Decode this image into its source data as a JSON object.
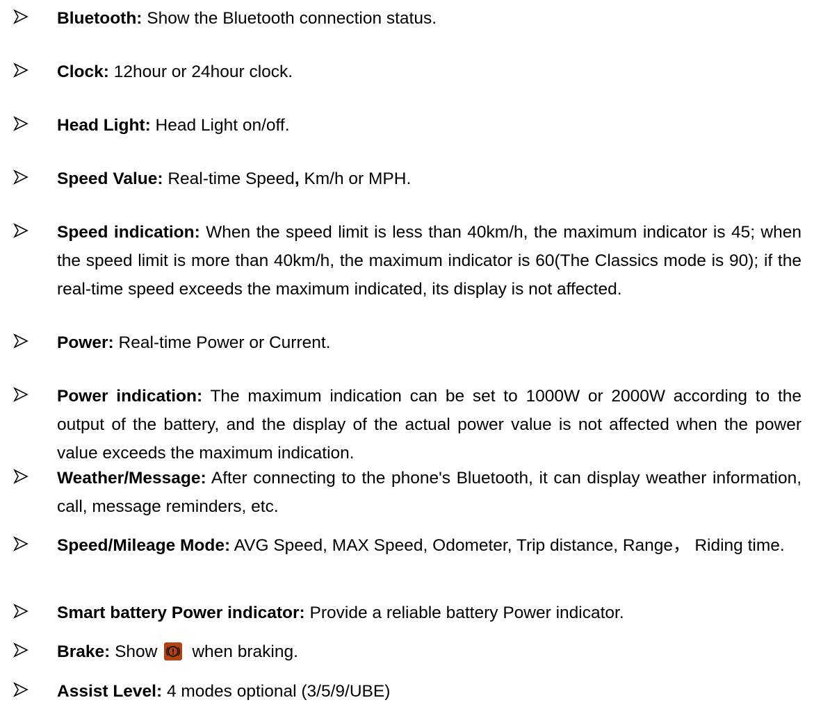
{
  "items": [
    {
      "term": "Bluetooth:",
      "desc": " Show the Bluetooth connection status."
    },
    {
      "term": "Clock:",
      "desc": " 12hour or 24hour clock."
    },
    {
      "term": "Head Light:",
      "desc": " Head Light on/off."
    },
    {
      "term": "Speed Value:",
      "desc": " Real-time Speed",
      "desc_bold": ",",
      "desc_after": " Km/h or MPH."
    },
    {
      "term": "Speed indication:",
      "desc": " When the speed limit is less than 40km/h, the maximum indicator is 45; when the speed limit is more than 40km/h, the maximum indicator is 60(The Classics mode is 90); if the real-time speed exceeds the maximum indicated, its display is not affected."
    },
    {
      "term": "Power:",
      "desc": " Real-time Power or Current."
    },
    {
      "term": "Power indication:",
      "desc": " The maximum indication can be set to 1000W or 2000W according to the output of the battery, and the display of the actual power value is not affected when the power value exceeds the maximum indication."
    },
    {
      "term": "Weather/Message:",
      "desc": " After connecting to the phone's Bluetooth, it can display weather information, call, message reminders, etc."
    },
    {
      "term": "Speed/Mileage Mode:",
      "desc": " AVG Speed, MAX Speed, Odometer, Trip distance, Range， Riding time."
    },
    {
      "term": "Smart battery Power indicator:",
      "desc": " Provide a reliable battery Power indicator."
    },
    {
      "term": "Brake:",
      "desc_before_icon": " Show",
      "icon": "brake-warning-icon",
      "desc_after_icon": "when braking."
    },
    {
      "term": "Assist Level:",
      "desc": " 4 modes optional (3/5/9/UBE)"
    }
  ],
  "colors": {
    "text": "#000000",
    "brake_icon": "#b7410e"
  }
}
